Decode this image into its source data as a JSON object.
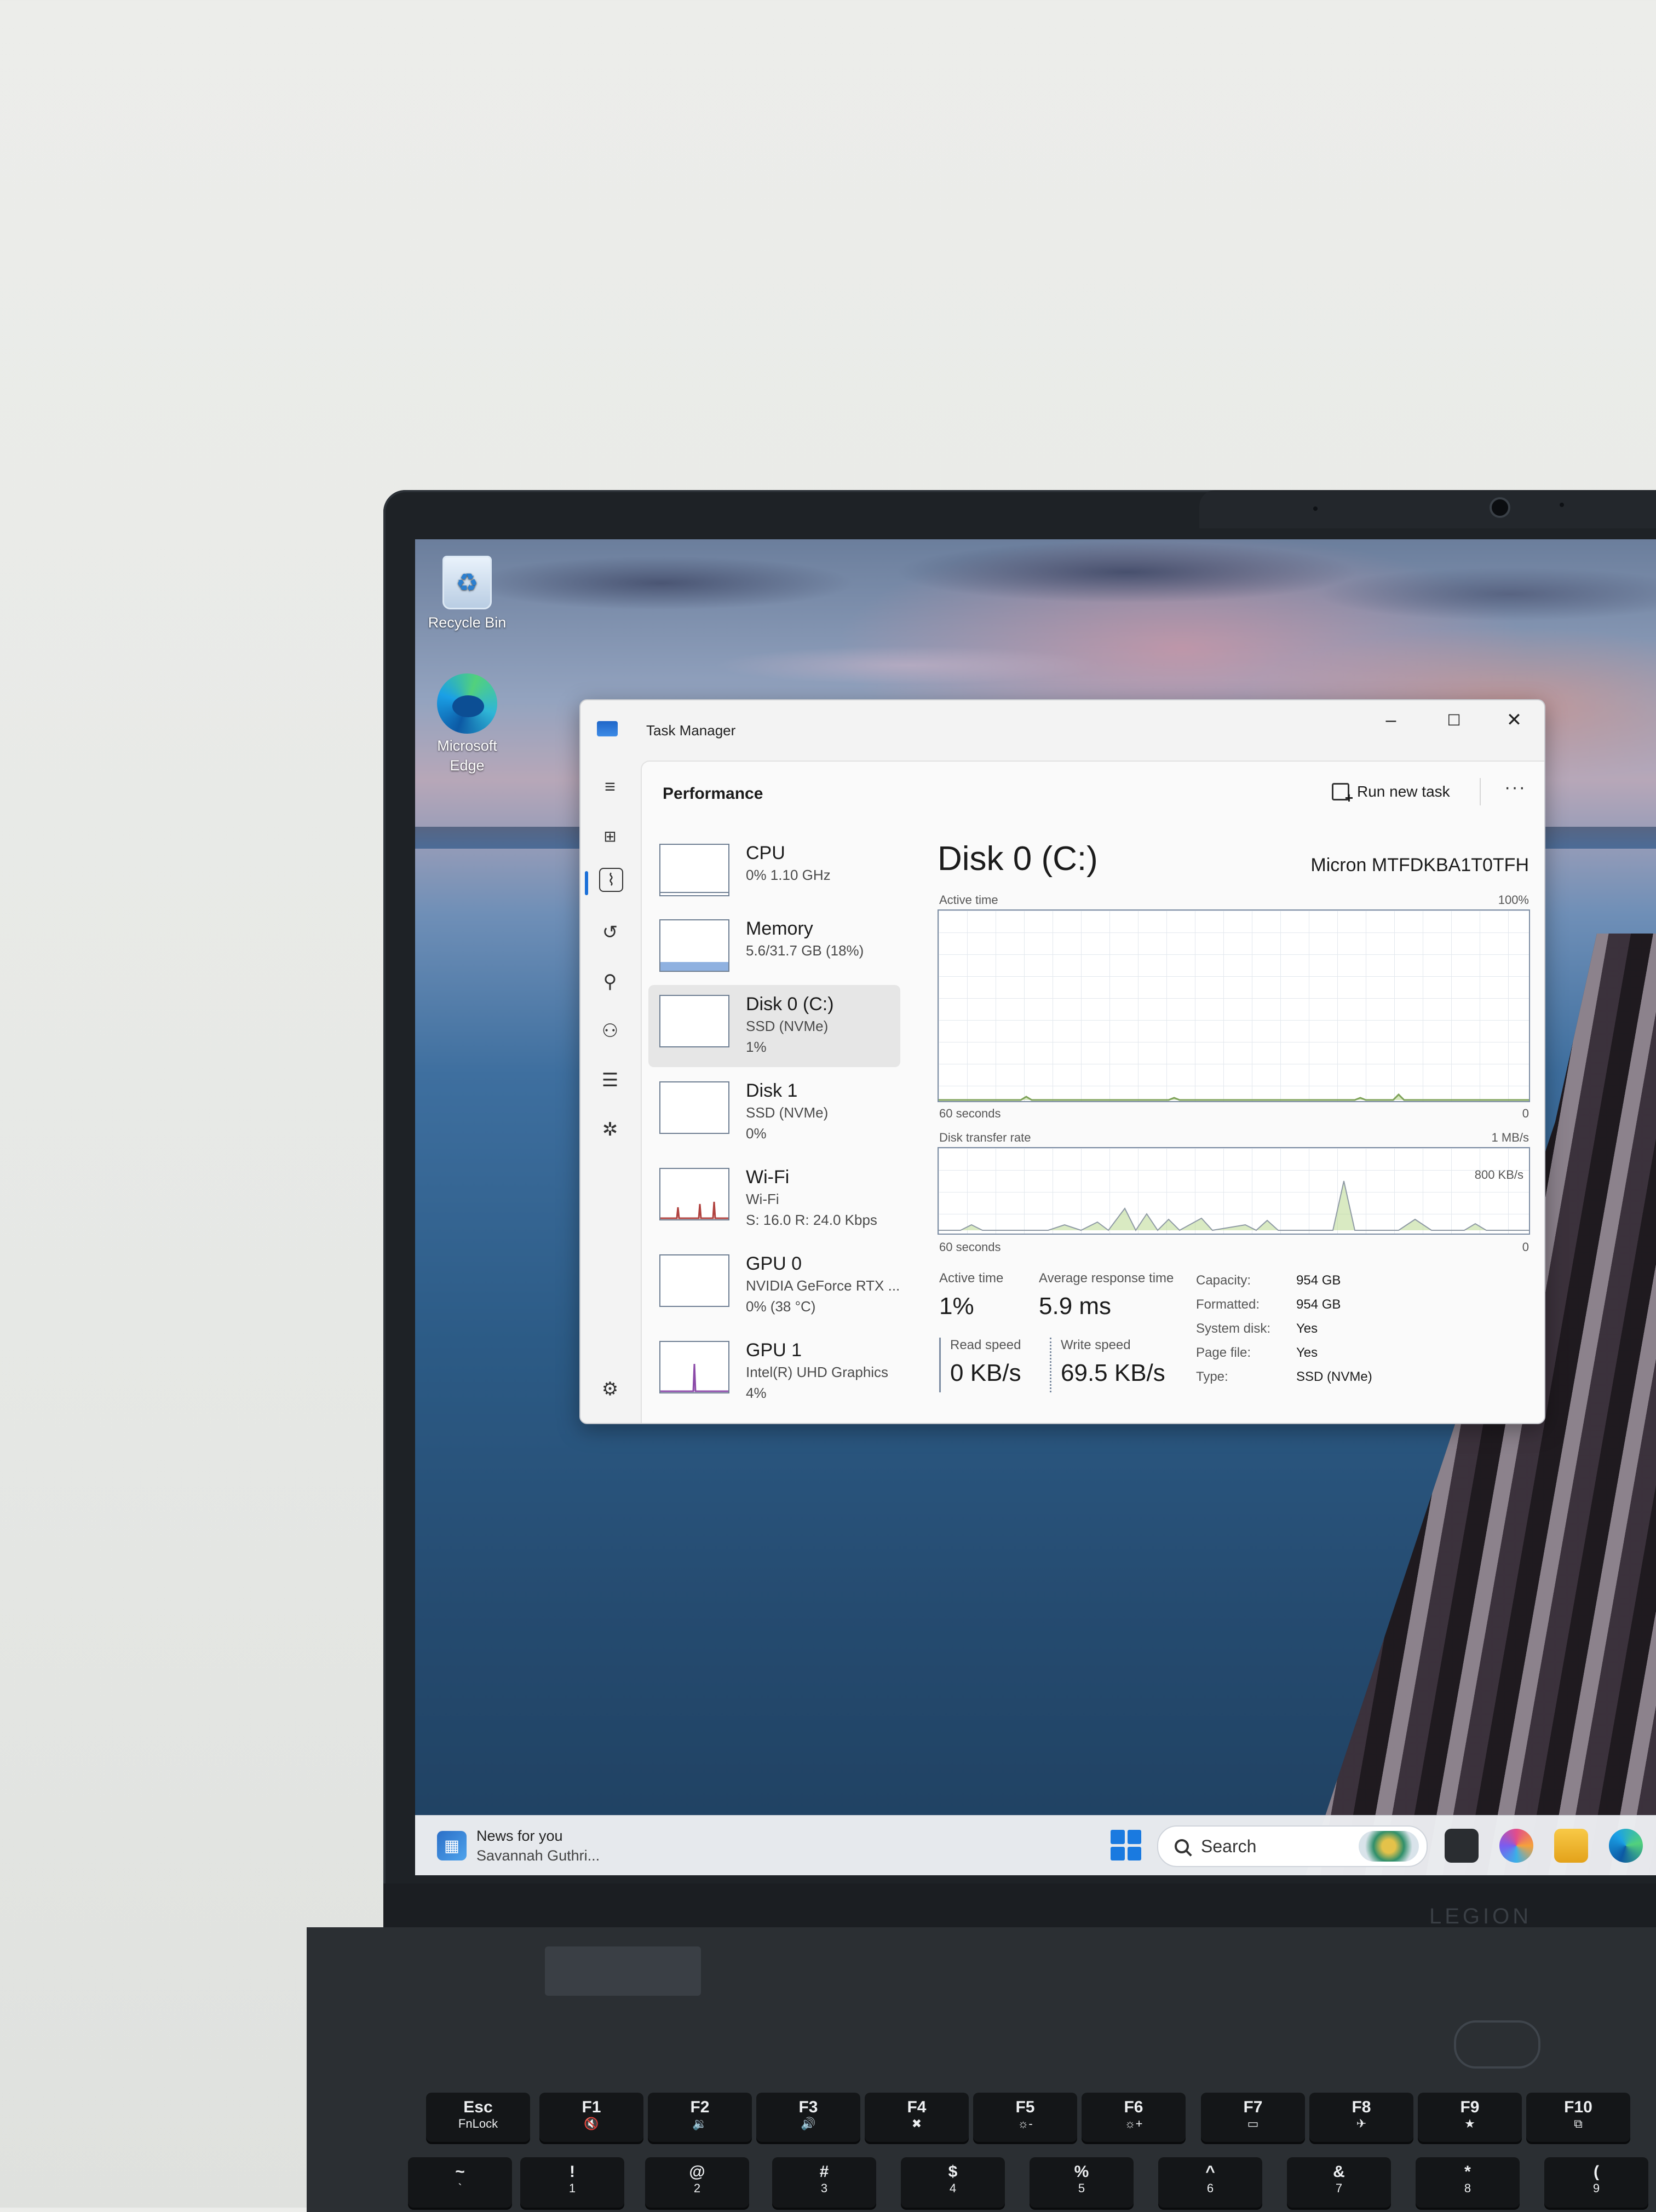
{
  "desktop": {
    "icons": [
      {
        "label": "Recycle Bin",
        "icon": "recycle-bin-icon"
      },
      {
        "label": "Microsoft Edge",
        "icon": "edge-icon"
      }
    ]
  },
  "taskbar": {
    "news_title": "News for you",
    "news_subtitle": "Savannah Guthri...",
    "search_label": "Search",
    "apps": [
      "terminal-icon",
      "copilot-icon",
      "file-explorer-icon",
      "edge-icon"
    ]
  },
  "task_manager": {
    "window_title": "Task Manager",
    "window_controls": {
      "minimize": "–",
      "maximize": "☐",
      "close": "✕"
    },
    "page_title": "Performance",
    "run_new_task": "Run new task",
    "more": "···",
    "devices": [
      {
        "name": "CPU",
        "lines": [
          "0%  1.10 GHz"
        ],
        "selected": false
      },
      {
        "name": "Memory",
        "lines": [
          "5.6/31.7 GB (18%)"
        ],
        "selected": false
      },
      {
        "name": "Disk 0 (C:)",
        "lines": [
          "SSD (NVMe)",
          "1%"
        ],
        "selected": true
      },
      {
        "name": "Disk 1",
        "lines": [
          "SSD (NVMe)",
          "0%"
        ],
        "selected": false
      },
      {
        "name": "Wi-Fi",
        "lines": [
          "Wi-Fi",
          "S: 16.0  R: 24.0 Kbps"
        ],
        "selected": false
      },
      {
        "name": "GPU 0",
        "lines": [
          "NVIDIA GeForce RTX ...",
          "0% (38 °C)"
        ],
        "selected": false
      },
      {
        "name": "GPU 1",
        "lines": [
          "Intel(R) UHD Graphics",
          "4%"
        ],
        "selected": false
      }
    ],
    "detail": {
      "title": "Disk 0 (C:)",
      "model": "Micron MTFDKBA1T0TFH",
      "active_time_graph": {
        "label": "Active time",
        "max": "100%",
        "x_label": "60 seconds",
        "min": "0"
      },
      "transfer_graph": {
        "label": "Disk transfer rate",
        "max": "1 MB/s",
        "inner_label": "800 KB/s",
        "x_label": "60 seconds",
        "min": "0"
      },
      "stats": {
        "active_time_label": "Active time",
        "active_time_value": "1%",
        "avg_response_label": "Average response time",
        "avg_response_value": "5.9 ms",
        "read_speed_label": "Read speed",
        "read_speed_value": "0 KB/s",
        "write_speed_label": "Write speed",
        "write_speed_value": "69.5 KB/s"
      },
      "properties": [
        {
          "label": "Capacity:",
          "value": "954 GB"
        },
        {
          "label": "Formatted:",
          "value": "954 GB"
        },
        {
          "label": "System disk:",
          "value": "Yes"
        },
        {
          "label": "Page file:",
          "value": "Yes"
        },
        {
          "label": "Type:",
          "value": "SSD (NVMe)"
        }
      ]
    }
  },
  "hardware": {
    "brand": "LEGION",
    "keys": [
      {
        "top": "Esc",
        "sub": "FnLock"
      },
      {
        "top": "F1",
        "sub": "🔇"
      },
      {
        "top": "F2",
        "sub": "🔉"
      },
      {
        "top": "F3",
        "sub": "🔊"
      },
      {
        "top": "F4",
        "sub": "✖"
      },
      {
        "top": "F5",
        "sub": "☼-"
      },
      {
        "top": "F6",
        "sub": "☼+"
      },
      {
        "top": "F7",
        "sub": "▭"
      },
      {
        "top": "F8",
        "sub": "✈"
      },
      {
        "top": "F9",
        "sub": "★"
      },
      {
        "top": "F10",
        "sub": "⧉"
      }
    ],
    "number_keys": [
      {
        "top": "~",
        "sub": "`"
      },
      {
        "top": "!",
        "sub": "1"
      },
      {
        "top": "@",
        "sub": "2"
      },
      {
        "top": "#",
        "sub": "3"
      },
      {
        "top": "$",
        "sub": "4"
      },
      {
        "top": "%",
        "sub": "5"
      },
      {
        "top": "^",
        "sub": "6"
      },
      {
        "top": "&",
        "sub": "7"
      },
      {
        "top": "*",
        "sub": "8"
      },
      {
        "top": "(",
        "sub": "9"
      }
    ]
  },
  "colors": {
    "accent": "#1a6fd8",
    "disk_graph_line": "#7fa35a",
    "disk_graph_fill": "#b9d98f",
    "wifi_graph": "#b0413e",
    "memory_graph": "#8fb1e0",
    "gpu_graph": "#8b4aa8"
  }
}
